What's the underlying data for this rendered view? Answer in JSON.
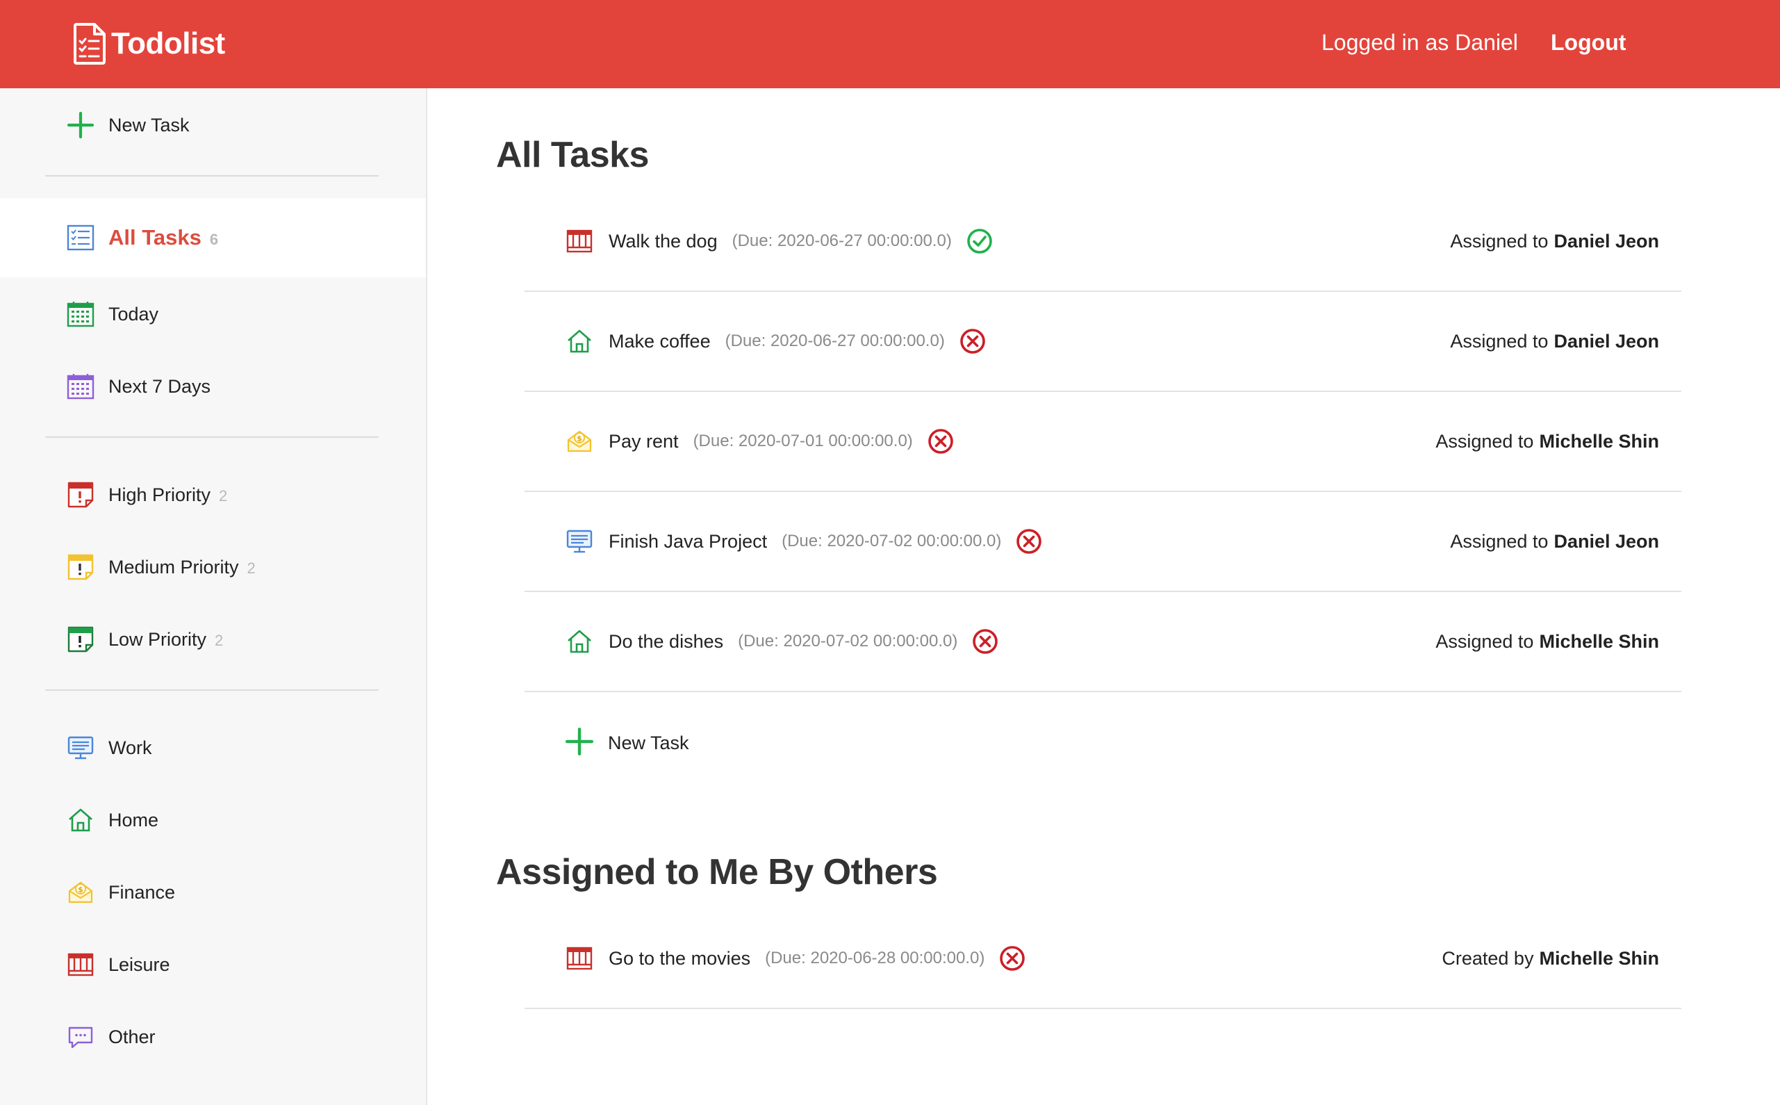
{
  "app": {
    "title": "Todolist"
  },
  "header": {
    "user_label": "Logged in as Daniel",
    "logout_label": "Logout"
  },
  "colors": {
    "brand": "#e2443b",
    "active": "#db4c3f",
    "done": "#22b14c",
    "not_done": "#cc1f27"
  },
  "sidebar": {
    "new_task": "New Task",
    "views": [
      {
        "label": "All Tasks",
        "count": "6",
        "icon": "checklist-icon"
      },
      {
        "label": "Today",
        "icon": "calendar-icon"
      },
      {
        "label": "Next 7 Days",
        "icon": "calendar-week-icon"
      }
    ],
    "priorities": [
      {
        "label": "High Priority",
        "count": "2",
        "icon": "high-priority-icon"
      },
      {
        "label": "Medium Priority",
        "count": "2",
        "icon": "medium-priority-icon"
      },
      {
        "label": "Low Priority",
        "count": "2",
        "icon": "low-priority-icon"
      }
    ],
    "categories": [
      {
        "label": "Work",
        "icon": "monitor-icon"
      },
      {
        "label": "Home",
        "icon": "house-icon"
      },
      {
        "label": "Finance",
        "icon": "money-envelope-icon"
      },
      {
        "label": "Leisure",
        "icon": "theater-icon"
      },
      {
        "label": "Other",
        "icon": "chat-bubble-icon"
      }
    ]
  },
  "main": {
    "all_tasks_title": "All Tasks",
    "tasks": [
      {
        "name": "Walk the dog",
        "due": "(Due: 2020-06-27 00:00:00.0)",
        "done": true,
        "assign_prefix": "Assigned to",
        "person": "Daniel Jeon",
        "category": "leisure"
      },
      {
        "name": "Make coffee",
        "due": "(Due: 2020-06-27 00:00:00.0)",
        "done": false,
        "assign_prefix": "Assigned to",
        "person": "Daniel Jeon",
        "category": "home"
      },
      {
        "name": "Pay rent",
        "due": "(Due: 2020-07-01 00:00:00.0)",
        "done": false,
        "assign_prefix": "Assigned to",
        "person": "Michelle Shin",
        "category": "finance"
      },
      {
        "name": "Finish Java Project",
        "due": "(Due: 2020-07-02 00:00:00.0)",
        "done": false,
        "assign_prefix": "Assigned to",
        "person": "Daniel Jeon",
        "category": "work"
      },
      {
        "name": "Do the dishes",
        "due": "(Due: 2020-07-02 00:00:00.0)",
        "done": false,
        "assign_prefix": "Assigned to",
        "person": "Michelle Shin",
        "category": "home"
      }
    ],
    "new_task": "New Task",
    "assigned_title": "Assigned to Me By Others",
    "assigned_tasks": [
      {
        "name": "Go to the movies",
        "due": "(Due: 2020-06-28 00:00:00.0)",
        "done": false,
        "assign_prefix": "Created by",
        "person": "Michelle Shin",
        "category": "leisure"
      }
    ]
  }
}
